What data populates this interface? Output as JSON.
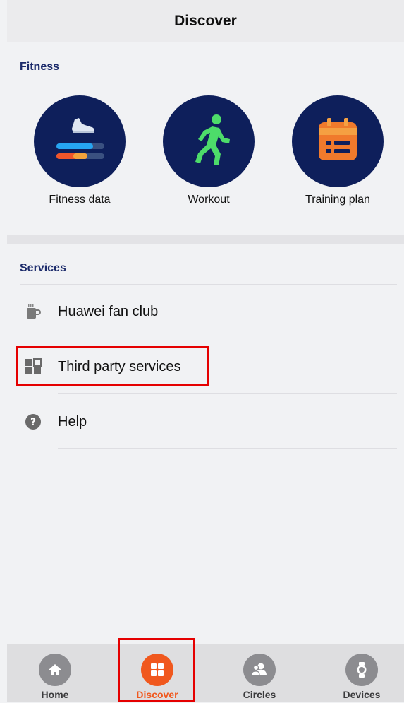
{
  "header": {
    "title": "Discover"
  },
  "fitness": {
    "section_title": "Fitness",
    "items": [
      {
        "label": "Fitness data",
        "icon": "running-shoe-icon"
      },
      {
        "label": "Workout",
        "icon": "runner-icon"
      },
      {
        "label": "Training plan",
        "icon": "calendar-plan-icon"
      }
    ]
  },
  "services": {
    "section_title": "Services",
    "items": [
      {
        "label": "Huawei fan club",
        "icon": "coffee-cup-icon"
      },
      {
        "label": "Third party services",
        "icon": "grid-apps-icon"
      },
      {
        "label": "Help",
        "icon": "help-icon"
      }
    ]
  },
  "tabbar": {
    "tabs": [
      {
        "label": "Home",
        "icon": "home-icon",
        "active": false
      },
      {
        "label": "Discover",
        "icon": "discover-grid-icon",
        "active": true
      },
      {
        "label": "Circles",
        "icon": "circles-people-icon",
        "active": false
      },
      {
        "label": "Devices",
        "icon": "watch-icon",
        "active": false
      }
    ]
  },
  "colors": {
    "accent": "#f0581e",
    "section_title": "#1c2b6b",
    "circle_bg": "#0e1f5b",
    "highlight": "#e50000"
  }
}
